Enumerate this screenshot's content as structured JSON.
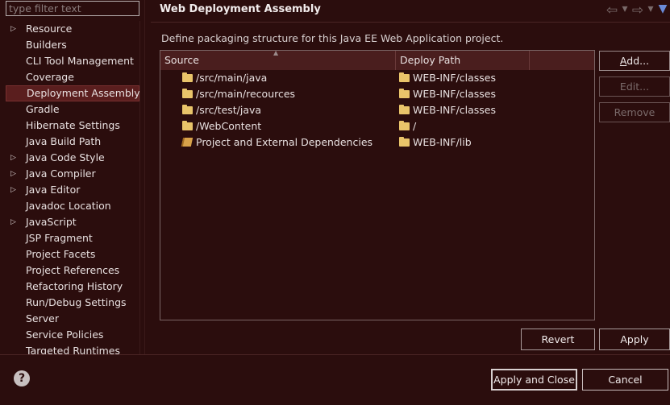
{
  "filter": {
    "placeholder": "type filter text"
  },
  "sidebar": {
    "items": [
      {
        "label": "Resource",
        "expandable": true
      },
      {
        "label": "Builders",
        "expandable": false
      },
      {
        "label": "CLI Tool Management",
        "expandable": false
      },
      {
        "label": "Coverage",
        "expandable": false
      },
      {
        "label": "Deployment Assembly",
        "expandable": false,
        "selected": true
      },
      {
        "label": "Gradle",
        "expandable": false
      },
      {
        "label": "Hibernate Settings",
        "expandable": false
      },
      {
        "label": "Java Build Path",
        "expandable": false
      },
      {
        "label": "Java Code Style",
        "expandable": true
      },
      {
        "label": "Java Compiler",
        "expandable": true
      },
      {
        "label": "Java Editor",
        "expandable": true
      },
      {
        "label": "Javadoc Location",
        "expandable": false
      },
      {
        "label": "JavaScript",
        "expandable": true
      },
      {
        "label": "JSP Fragment",
        "expandable": false
      },
      {
        "label": "Project Facets",
        "expandable": false
      },
      {
        "label": "Project References",
        "expandable": false
      },
      {
        "label": "Refactoring History",
        "expandable": false
      },
      {
        "label": "Run/Debug Settings",
        "expandable": false
      },
      {
        "label": "Server",
        "expandable": false
      },
      {
        "label": "Service Policies",
        "expandable": false
      },
      {
        "label": "Targeted Runtimes",
        "expandable": false
      }
    ]
  },
  "page": {
    "title": "Web Deployment Assembly",
    "description": "Define packaging structure for this Java EE Web Application project."
  },
  "table": {
    "headers": {
      "source": "Source",
      "deploy": "Deploy Path"
    },
    "rows": [
      {
        "source": "/src/main/java",
        "source_icon": "folder-icon",
        "deploy": "WEB-INF/classes"
      },
      {
        "source": "/src/main/recources",
        "source_icon": "folder-icon",
        "deploy": "WEB-INF/classes"
      },
      {
        "source": "/src/test/java",
        "source_icon": "folder-icon",
        "deploy": "WEB-INF/classes"
      },
      {
        "source": "/WebContent",
        "source_icon": "folder-icon",
        "deploy": "/"
      },
      {
        "source": "Project and External Dependencies",
        "source_icon": "library-icon",
        "deploy": "WEB-INF/lib"
      }
    ]
  },
  "buttons": {
    "add": "Add...",
    "edit": "Edit...",
    "remove": "Remove",
    "revert": "Revert",
    "apply": "Apply",
    "apply_close": "Apply and Close",
    "cancel": "Cancel",
    "help": "?"
  },
  "colors": {
    "background": "#2b0d0d",
    "selection": "#5a1e1e",
    "header": "#4a1e1e",
    "folder": "#e9c46a",
    "nav_menu": "#6a8ad8"
  }
}
